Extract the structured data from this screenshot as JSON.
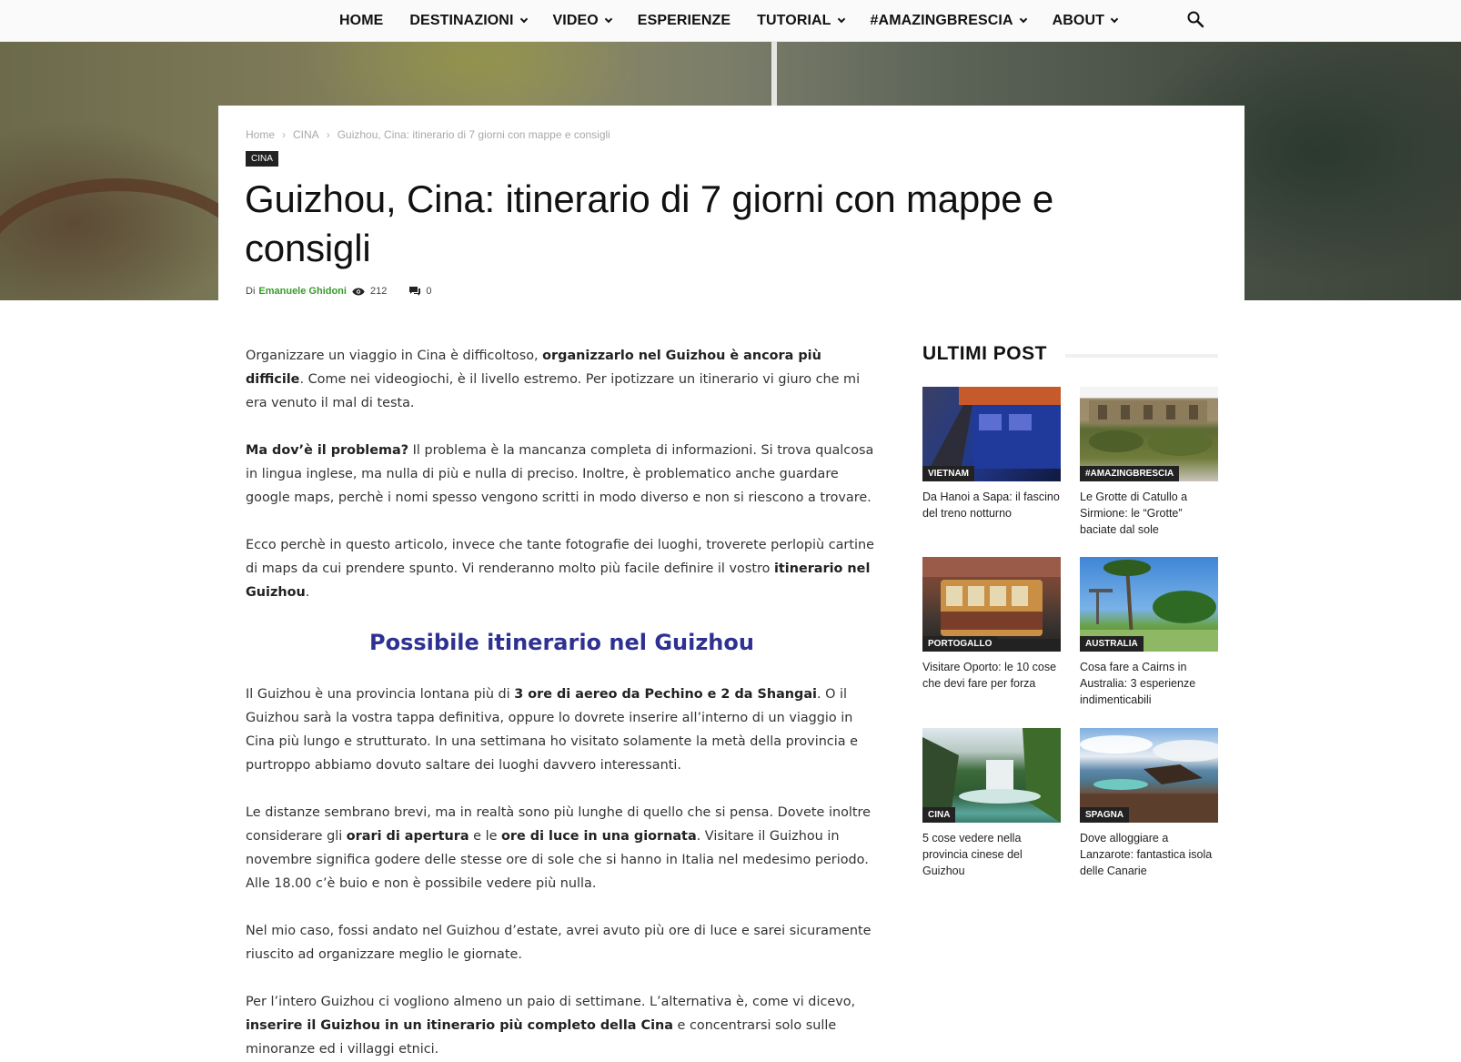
{
  "nav": {
    "items": [
      {
        "label": "HOME",
        "has_dropdown": false
      },
      {
        "label": "DESTINAZIONI",
        "has_dropdown": true
      },
      {
        "label": "VIDEO",
        "has_dropdown": true
      },
      {
        "label": "ESPERIENZE",
        "has_dropdown": false
      },
      {
        "label": "TUTORIAL",
        "has_dropdown": true
      },
      {
        "label": "#AMAZINGBRESCIA",
        "has_dropdown": true
      },
      {
        "label": "ABOUT",
        "has_dropdown": true
      }
    ],
    "search_icon": "search-icon"
  },
  "breadcrumb": {
    "home": "Home",
    "category": "CINA",
    "current": "Guizhou, Cina: itinerario di 7 giorni con mappe e consigli"
  },
  "article": {
    "category_tag": "CINA",
    "title": "Guizhou, Cina: itinerario di 7 giorni con mappe e consigli",
    "by_label": "Di",
    "author": "Emanuele Ghidoni",
    "views": "212",
    "comments": "0"
  },
  "content": {
    "p1_a": "Organizzare un viaggio in Cina è difficoltoso, ",
    "p1_b": "organizzarlo nel Guizhou è ancora più difficile",
    "p1_c": ". Come nei videogiochi, è il livello estremo. Per ipotizzare un itinerario vi giuro che mi era venuto il mal di testa.",
    "p2_a": "Ma dov’è il problema?",
    "p2_b": " Il problema è la mancanza completa di informazioni. Si trova qualcosa in lingua inglese, ma nulla di più e nulla di preciso. Inoltre, è problematico anche guardare google maps, perchè i nomi spesso vengono scritti in modo diverso e non si riescono a trovare.",
    "p3_a": "Ecco perchè in questo articolo, invece che tante fotografie dei luoghi, troverete perlopiù cartine di maps da cui prendere spunto. Vi renderanno molto più facile definire il vostro ",
    "p3_b": "itinerario nel Guizhou",
    "p3_c": ".",
    "h2": "Possibile itinerario nel Guizhou",
    "p4_a": "Il Guizhou è una provincia lontana più di ",
    "p4_b": "3 ore di aereo da Pechino e 2 da Shangai",
    "p4_c": ". O il Guizhou sarà la vostra tappa definitiva, oppure lo dovrete inserire all’interno di un viaggio in Cina più lungo e strutturato. In una settimana ho visitato solamente la metà della provincia e purtroppo abbiamo dovuto saltare dei luoghi davvero interessanti.",
    "p5_a": "Le distanze sembrano brevi, ma in realtà sono più lunghe di quello che si pensa. Dovete inoltre considerare gli ",
    "p5_b": "orari di apertura",
    "p5_c": " e le ",
    "p5_d": "ore di luce in una giornata",
    "p5_e": ". Visitare il Guizhou in novembre significa godere delle stesse ore di sole che si hanno in Italia nel medesimo periodo. Alle 18.00 c’è buio e non è possibile vedere più nulla.",
    "p6": "Nel mio caso, fossi andato nel Guizhou d’estate, avrei avuto più ore di luce e sarei sicuramente riuscito ad organizzare meglio le giornate.",
    "p7_a": "Per l’intero Guizhou ci vogliono almeno un paio di settimane. L’alternativa è, come vi dicevo, ",
    "p7_b": "inserire il Guizhou in un itinerario più completo della Cina",
    "p7_c": " e concentrarsi solo sulle minoranze ed i villaggi etnici."
  },
  "sidebar": {
    "title": "ULTIMI POST",
    "posts": [
      {
        "category": "VIETNAM",
        "title": "Da Hanoi a Sapa: il fascino del treno notturno"
      },
      {
        "category": "#AMAZINGBRESCIA",
        "title": "Le Grotte di Catullo a Sirmione: le “Grotte” baciate dal sole"
      },
      {
        "category": "PORTOGALLO",
        "title": "Visitare Oporto: le 10 cose che devi fare per forza"
      },
      {
        "category": "AUSTRALIA",
        "title": "Cosa fare a Cairns in Australia: 3 esperienze indimenticabili"
      },
      {
        "category": "CINA",
        "title": "5 cose vedere nella provincia cinese del Guizhou"
      },
      {
        "category": "SPAGNA",
        "title": "Dove alloggiare a Lanzarote: fantastica isola delle Canarie"
      }
    ]
  },
  "colors": {
    "heading_accent": "#2e3192",
    "author_green": "#3a9b2b",
    "tag_bg": "#222222"
  }
}
